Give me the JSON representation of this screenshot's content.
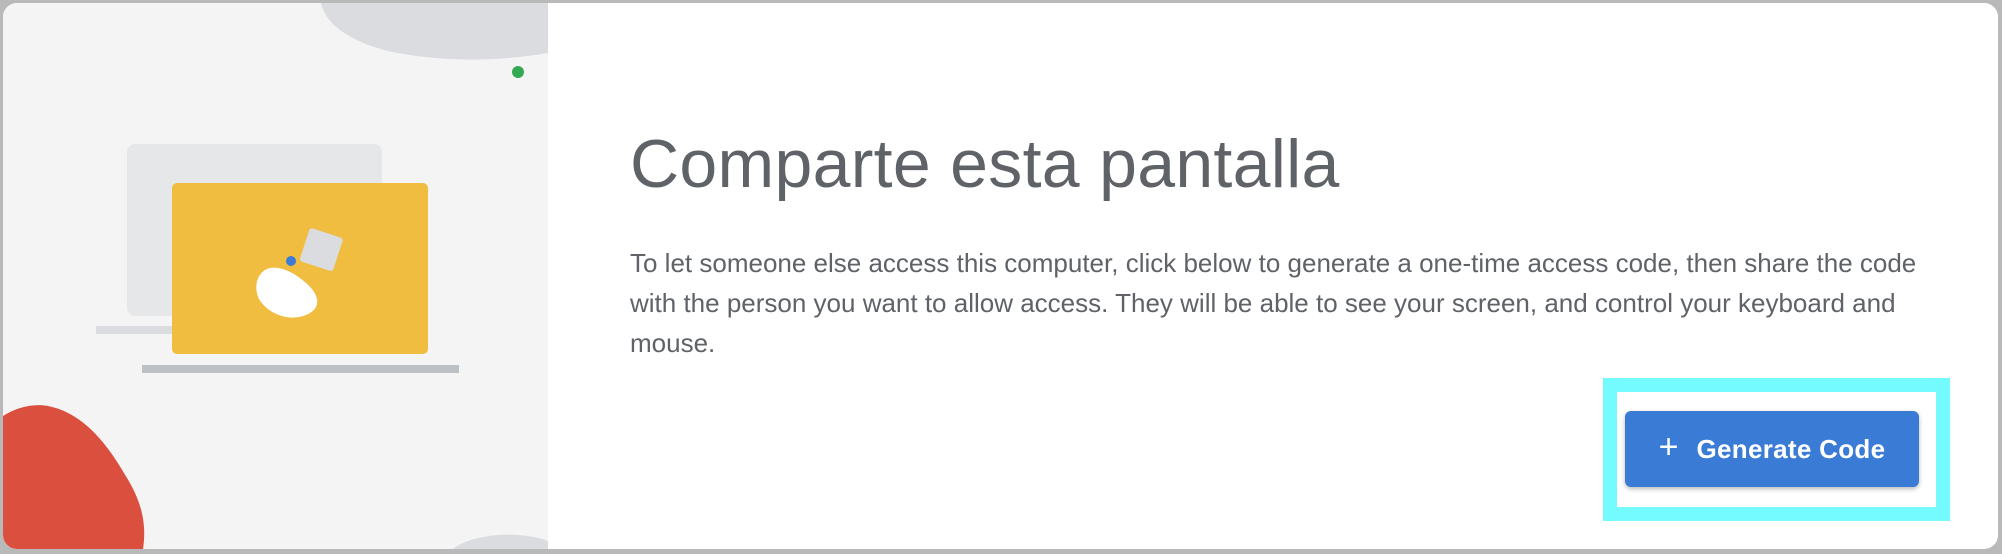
{
  "main": {
    "title": "Comparte esta pantalla",
    "description": "To let someone else access this computer, click below to generate a one-time access code, then share the code with the person you want to allow access. They will be able to see your screen, and control your keyboard and mouse."
  },
  "actions": {
    "generate_code_label": "Generate Code",
    "generate_code_icon": "plus-icon"
  },
  "colors": {
    "button": "#3a7bd5",
    "highlight": "#74fbff",
    "laptop_screen": "#f0bd40",
    "accent_red": "#db4f3f",
    "status_dot": "#34a853",
    "text": "#5f6368"
  }
}
